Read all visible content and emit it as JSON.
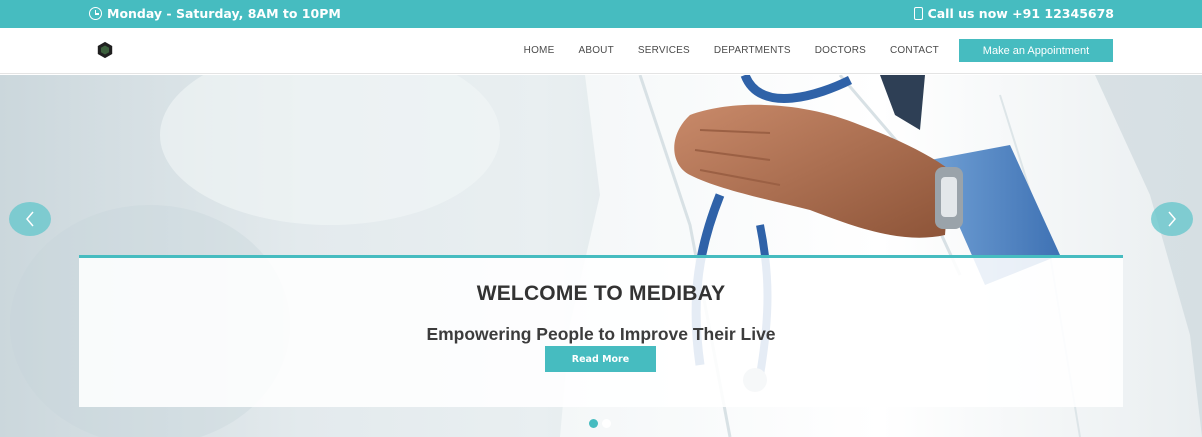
{
  "topbar": {
    "hours": "Monday - Saturday, 8AM to 10PM",
    "phone": "Call us now +91 12345678",
    "hours_icon": "clock-icon",
    "phone_icon": "phone-icon"
  },
  "nav": {
    "logo_icon": "hexagon-logo-icon",
    "links": [
      "HOME",
      "ABOUT",
      "SERVICES",
      "DEPARTMENTS",
      "DOCTORS",
      "CONTACT"
    ],
    "cta": "Make an Appointment"
  },
  "hero": {
    "title": "WELCOME TO MEDIBAY",
    "subtitle": "Empowering People to Improve Their Live",
    "button": "Read More",
    "prev_icon": "chevron-left-icon",
    "next_icon": "chevron-right-icon",
    "slide_count": 2,
    "active_slide": 1
  },
  "colors": {
    "accent": "#46bcc0",
    "text_dark": "#333333",
    "nav_text": "#4b4b4b"
  }
}
